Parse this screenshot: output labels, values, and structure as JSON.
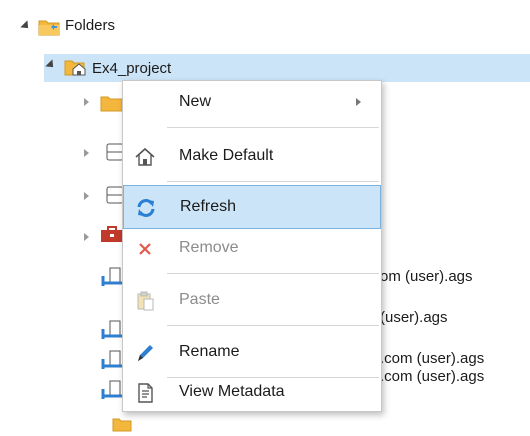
{
  "tree": {
    "root": {
      "label": "Folders",
      "icon": "folder-icon"
    },
    "project": {
      "label": "Ex4_project",
      "icon": "home-folder-icon"
    },
    "hidden_children": [
      "folder-icon",
      "database-icon",
      "database-icon",
      "toolbox-icon"
    ],
    "connections": [
      {
        "label": "om (user).ags",
        "icon": "server-connection-icon"
      },
      {
        "label": "(user).ags",
        "icon": "server-connection-icon"
      },
      {
        "label": ".com (user).ags",
        "icon": "server-connection-icon"
      },
      {
        "label": ".com (user).ags",
        "icon": "server-connection-icon"
      }
    ]
  },
  "context_menu": {
    "items": [
      {
        "label": "New",
        "icon": "none",
        "enabled": true,
        "submenu": true
      },
      {
        "label": "Make Default",
        "icon": "home-icon",
        "enabled": true
      },
      {
        "label": "Refresh",
        "icon": "refresh-icon",
        "enabled": true,
        "highlighted": true
      },
      {
        "label": "Remove",
        "icon": "remove-x-icon",
        "enabled": false
      },
      {
        "label": "Paste",
        "icon": "paste-icon",
        "enabled": false
      },
      {
        "label": "Rename",
        "icon": "rename-pen-icon",
        "enabled": true
      },
      {
        "label": "View Metadata",
        "icon": "metadata-document-icon",
        "enabled": true
      }
    ]
  },
  "colors": {
    "selection": "#cce4f7",
    "folder": "#f4b73d",
    "refresh": "#2a7fd4",
    "remove": "#e05a4b",
    "connection": "#2f7fd0"
  }
}
